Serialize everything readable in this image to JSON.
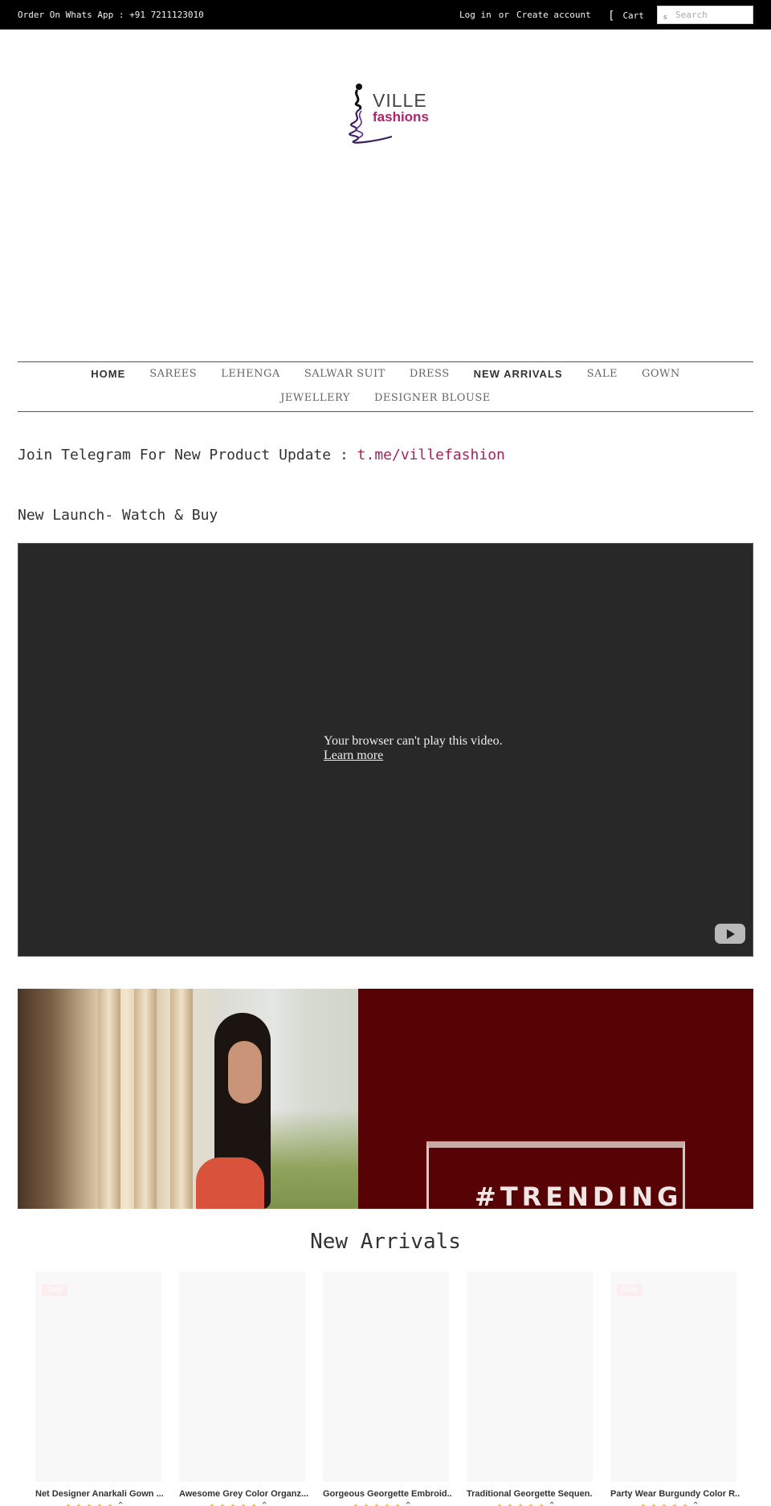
{
  "topbar": {
    "order_text": "Order On Whats App : +91 7211123010",
    "login_label": "Log in",
    "or_label": "or",
    "create_account_label": "Create account",
    "cart_icon": "[",
    "cart_label": "Cart",
    "search_icon": "s",
    "search_placeholder": "Search",
    "search_value": ""
  },
  "logo": {
    "brand_top": "VILLE",
    "brand_bottom": "fashions"
  },
  "nav": {
    "items": [
      {
        "label": "HOME",
        "bold": true
      },
      {
        "label": "SAREES",
        "bold": false
      },
      {
        "label": "LEHENGA",
        "bold": false
      },
      {
        "label": "SALWAR SUIT",
        "bold": false
      },
      {
        "label": "DRESS",
        "bold": false
      },
      {
        "label": "NEW ARRIVALS",
        "bold": true
      },
      {
        "label": "SALE",
        "bold": false
      },
      {
        "label": "GOWN",
        "bold": false
      },
      {
        "label": "JEWELLERY",
        "bold": false
      },
      {
        "label": "DESIGNER BLOUSE",
        "bold": false
      }
    ]
  },
  "telegram": {
    "text": "Join Telegram For New Product Update : ",
    "link_text": "t.me/villefashion"
  },
  "launch": {
    "title": "New Launch- Watch & Buy",
    "video_message": "Your browser can't play this video.",
    "video_learn_more": "Learn more"
  },
  "banner": {
    "text": "#TRENDING"
  },
  "arrivals": {
    "title": "New Arrivals",
    "products": [
      {
        "title": "Net Designer Anarkali Gown ...",
        "badge": "Sale",
        "stars": "★★★★★",
        "star_suffix": "^"
      },
      {
        "title": "Awesome Grey Color Organz...",
        "badge": "",
        "stars": "★★★★★",
        "star_suffix": "^"
      },
      {
        "title": "Gorgeous Georgette Embroid..",
        "badge": "",
        "stars": "★★★★★",
        "star_suffix": "^"
      },
      {
        "title": "Traditional Georgette Sequen.",
        "badge": "",
        "stars": "★★★★★",
        "star_suffix": "^"
      },
      {
        "title": "Party Wear Burgundy Color R..",
        "badge": "Sale",
        "stars": "★★★★★",
        "star_suffix": "^"
      }
    ]
  },
  "colors": {
    "topbar_bg": "#000000",
    "accent_pink": "#a2245e",
    "logo_pink": "#b1236b",
    "video_bg": "#282828",
    "banner_maroon": "#570205",
    "star": "#f0b429"
  }
}
